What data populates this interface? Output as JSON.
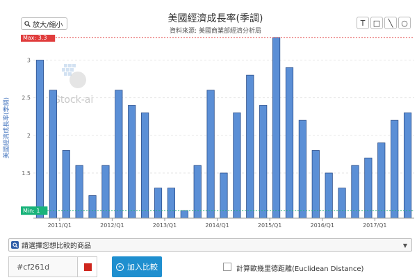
{
  "toolbar": {
    "zoom_label": "放大/縮小",
    "tools": [
      {
        "name": "text-tool-icon",
        "glyph": "T"
      },
      {
        "name": "rectangle-tool-icon",
        "glyph": "□"
      },
      {
        "name": "line-tool-icon",
        "glyph": "╲"
      },
      {
        "name": "circle-tool-icon",
        "glyph": "○"
      }
    ]
  },
  "chart_data": {
    "type": "bar",
    "title": "美國經濟成長率(季調)",
    "subtitle": "資料來源: 美國商業部經濟分析局",
    "ylabel": "美國經濟成長率(季調)",
    "xlabel": "",
    "ylim": [
      0.9,
      3.3
    ],
    "yticks": [
      {
        "v": 1,
        "label": "1"
      },
      {
        "v": 1.5,
        "label": "1.5"
      },
      {
        "v": 2,
        "label": "2"
      },
      {
        "v": 2.5,
        "label": "2.5"
      },
      {
        "v": 3,
        "label": "3"
      }
    ],
    "xticks": [
      {
        "i": 2,
        "label": "2011/Q1"
      },
      {
        "i": 6,
        "label": "2012/Q1"
      },
      {
        "i": 10,
        "label": "2013/Q1"
      },
      {
        "i": 14,
        "label": "2014/Q1"
      },
      {
        "i": 18,
        "label": "2015/Q1"
      },
      {
        "i": 22,
        "label": "2016/Q1"
      },
      {
        "i": 26,
        "label": "2017/Q1"
      }
    ],
    "values": [
      3.0,
      2.6,
      1.8,
      1.6,
      1.2,
      1.6,
      2.6,
      2.4,
      2.3,
      1.3,
      1.3,
      1.0,
      1.6,
      2.6,
      1.5,
      2.3,
      2.8,
      2.4,
      3.3,
      2.9,
      2.2,
      1.8,
      1.5,
      1.3,
      1.6,
      1.7,
      1.9,
      2.2,
      2.3
    ],
    "max_line": {
      "value": 3.3,
      "label": "Max: 3.3",
      "color": "#e03c3c"
    },
    "min_line": {
      "value": 1,
      "label": "Min: 1",
      "color": "#19b37a"
    },
    "bar_color": "#5b8fd6",
    "bar_stroke": "#2d4f8a",
    "watermark": "Stock-ai",
    "grid": true,
    "legend": "none"
  },
  "controls": {
    "select_placeholder": "請選擇您想比較的商品",
    "color_value": "#cf261d",
    "swatch_color": "#cf261d",
    "add_label": "加入比較",
    "euclid_label": "計算歐幾里德距離(Euclidean Distance)"
  }
}
